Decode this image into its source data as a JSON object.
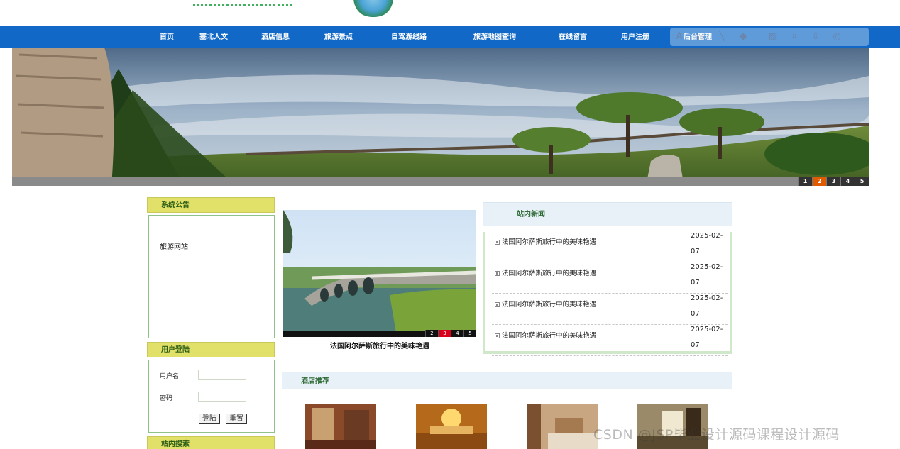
{
  "nav": {
    "items": [
      {
        "label": "首页"
      },
      {
        "label": "塞北人文"
      },
      {
        "label": "酒店信息"
      },
      {
        "label": "旅游景点"
      },
      {
        "label": "自驾游线路"
      },
      {
        "label": "旅游地图查询"
      },
      {
        "label": "在线留言"
      },
      {
        "label": "用户注册"
      },
      {
        "label": "后台管理"
      }
    ]
  },
  "banner": {
    "pager": [
      "1",
      "2",
      "3",
      "4",
      "5"
    ],
    "active": 2
  },
  "notice": {
    "title": "系统公告",
    "text": "旅游网站"
  },
  "login": {
    "title": "用户登陆",
    "username_label": "用户名",
    "password_label": "密码",
    "login_btn": "登陆",
    "reset_btn": "重置"
  },
  "search": {
    "title": "站内搜索"
  },
  "slider": {
    "pager": [
      "2",
      "3",
      "4",
      "5"
    ],
    "active": 3,
    "caption": "法国阿尔萨斯旅行中的美味艳遇"
  },
  "news": {
    "title": "站内新闻",
    "items": [
      {
        "title": "法国阿尔萨斯旅行中的美味艳遇",
        "date": "2025-02-07"
      },
      {
        "title": "法国阿尔萨斯旅行中的美味艳遇",
        "date": "2025-02-07"
      },
      {
        "title": "法国阿尔萨斯旅行中的美味艳遇",
        "date": "2025-02-07"
      },
      {
        "title": "法国阿尔萨斯旅行中的美味艳遇",
        "date": "2025-02-07"
      }
    ]
  },
  "hotels": {
    "title": "酒店推荐"
  },
  "watermark": "CSDN @JSP毕业设计源码课程设计源码"
}
